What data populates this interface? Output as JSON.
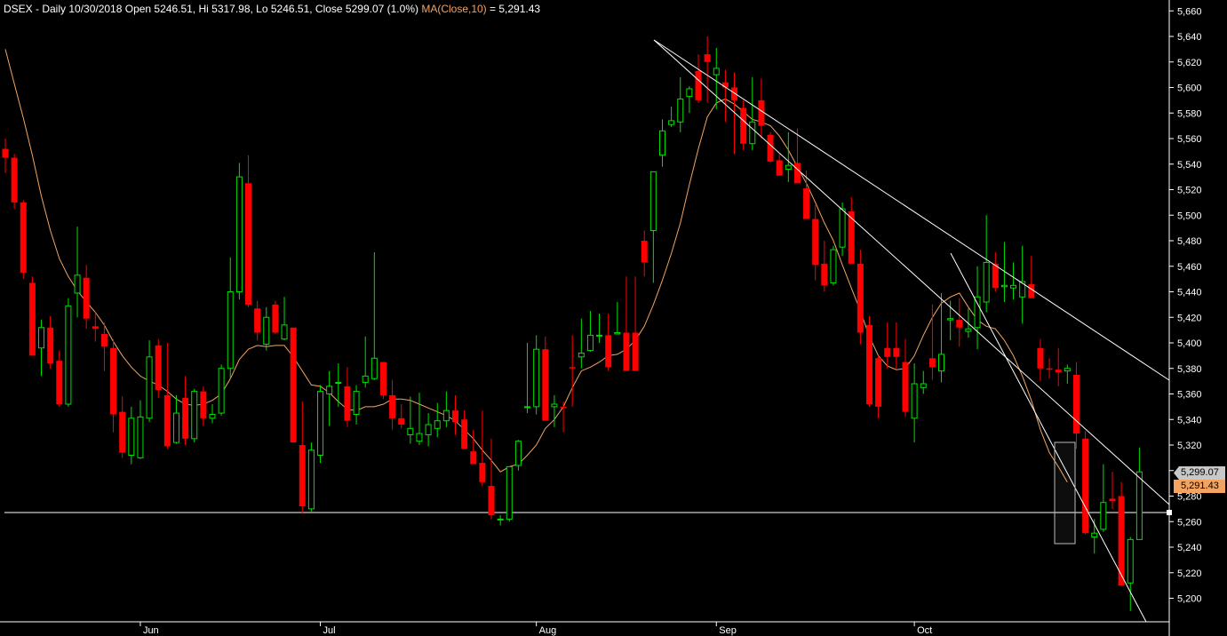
{
  "header": {
    "symbol_info": "DSEX - Daily 10/30/2018 Open 5246.51, Hi 5317.98, Lo 5246.51, Close 5299.07 (1.0%)",
    "ma_label": "MA(Close,10)",
    "ma_value": " = 5,291.43"
  },
  "price_tags": {
    "close": "5,299.07",
    "ma": "5,291.43"
  },
  "colors": {
    "background": "#000000",
    "up": "#00e000",
    "down": "#ff0000",
    "ma": "#f4a460",
    "trendline": "#ffffff",
    "axis_text": "#ffffff",
    "close_tag": "#c8c8c8",
    "ma_tag": "#f4a460"
  },
  "chart_data": {
    "type": "candlestick",
    "title": "DSEX - Daily",
    "ylim": [
      5190,
      5670
    ],
    "y_ticks": [
      5200,
      5220,
      5240,
      5260,
      5280,
      5300,
      5320,
      5340,
      5360,
      5380,
      5400,
      5420,
      5440,
      5460,
      5480,
      5500,
      5520,
      5540,
      5560,
      5580,
      5600,
      5620,
      5640,
      5660
    ],
    "y_tick_labels": [
      "5,200",
      "5,220",
      "5,240",
      "5,260",
      "5,280",
      "5,300",
      "5,320",
      "5,340",
      "5,360",
      "5,380",
      "5,400",
      "5,420",
      "5,440",
      "5,460",
      "5,480",
      "5,500",
      "5,520",
      "5,540",
      "5,560",
      "5,580",
      "5,600",
      "5,620",
      "5,640",
      "5,660"
    ],
    "x_labels": [
      {
        "label": "Jun",
        "index": 15
      },
      {
        "label": "Jul",
        "index": 35
      },
      {
        "label": "Aug",
        "index": 59
      },
      {
        "label": "Sep",
        "index": 79
      },
      {
        "label": "Oct",
        "index": 101
      }
    ],
    "candles": [
      [
        5552,
        5560,
        5533,
        5545
      ],
      [
        5545,
        5548,
        5505,
        5510
      ],
      [
        5510,
        5512,
        5450,
        5455
      ],
      [
        5447,
        5452,
        5390,
        5390
      ],
      [
        5396,
        5418,
        5374,
        5412
      ],
      [
        5412,
        5421,
        5380,
        5384
      ],
      [
        5386,
        5394,
        5350,
        5352
      ],
      [
        5352,
        5435,
        5350,
        5429
      ],
      [
        5439,
        5491,
        5420,
        5453
      ],
      [
        5451,
        5461,
        5411,
        5419
      ],
      [
        5413,
        5424,
        5401,
        5411
      ],
      [
        5407,
        5416,
        5378,
        5397
      ],
      [
        5396,
        5403,
        5330,
        5344
      ],
      [
        5346,
        5358,
        5310,
        5314
      ],
      [
        5312,
        5350,
        5305,
        5341
      ],
      [
        5310,
        5355,
        5309,
        5342
      ],
      [
        5341,
        5402,
        5338,
        5389
      ],
      [
        5398,
        5403,
        5357,
        5363
      ],
      [
        5359,
        5400,
        5317,
        5319
      ],
      [
        5322,
        5359,
        5321,
        5345
      ],
      [
        5357,
        5374,
        5320,
        5325
      ],
      [
        5325,
        5364,
        5322,
        5362
      ],
      [
        5362,
        5366,
        5335,
        5341
      ],
      [
        5341,
        5352,
        5337,
        5344
      ],
      [
        5345,
        5383,
        5343,
        5380
      ],
      [
        5380,
        5467,
        5372,
        5440
      ],
      [
        5440,
        5541,
        5434,
        5530
      ],
      [
        5525,
        5547,
        5428,
        5430
      ],
      [
        5427,
        5433,
        5402,
        5408
      ],
      [
        5399,
        5428,
        5394,
        5420
      ],
      [
        5430,
        5433,
        5407,
        5408
      ],
      [
        5403,
        5436,
        5402,
        5414
      ],
      [
        5412,
        5411,
        5389,
        5322
      ],
      [
        5320,
        5354,
        5267,
        5272
      ],
      [
        5270,
        5322,
        5268,
        5316
      ],
      [
        5312,
        5367,
        5306,
        5362
      ],
      [
        5360,
        5378,
        5335,
        5366
      ],
      [
        5369,
        5384,
        5350,
        5369
      ],
      [
        5366,
        5381,
        5334,
        5339
      ],
      [
        5344,
        5367,
        5336,
        5362
      ],
      [
        5369,
        5405,
        5365,
        5374
      ],
      [
        5372,
        5471,
        5371,
        5388
      ],
      [
        5385,
        5385,
        5356,
        5359
      ],
      [
        5359,
        5371,
        5332,
        5341
      ],
      [
        5341,
        5352,
        5333,
        5336
      ],
      [
        5328,
        5358,
        5321,
        5333
      ],
      [
        5323,
        5361,
        5320,
        5329
      ],
      [
        5328,
        5345,
        5319,
        5336
      ],
      [
        5333,
        5353,
        5326,
        5339
      ],
      [
        5339,
        5362,
        5334,
        5347
      ],
      [
        5347,
        5359,
        5328,
        5338
      ],
      [
        5340,
        5347,
        5322,
        5317
      ],
      [
        5315,
        5332,
        5306,
        5305
      ],
      [
        5306,
        5347,
        5288,
        5291
      ],
      [
        5288,
        5325,
        5262,
        5265
      ],
      [
        5262,
        5265,
        5257,
        5262
      ],
      [
        5262,
        5302,
        5260,
        5303
      ],
      [
        5304,
        5324,
        5300,
        5323
      ],
      [
        5350,
        5400,
        5345,
        5350
      ],
      [
        5350,
        5406,
        5344,
        5395
      ],
      [
        5395,
        5405,
        5340,
        5339
      ],
      [
        5350,
        5359,
        5334,
        5352
      ],
      [
        5350,
        5354,
        5330,
        5349
      ],
      [
        5381,
        5406,
        5350,
        5380
      ],
      [
        5389,
        5419,
        5380,
        5392
      ],
      [
        5394,
        5425,
        5393,
        5406
      ],
      [
        5406,
        5423,
        5400,
        5406
      ],
      [
        5406,
        5423,
        5378,
        5381
      ],
      [
        5407,
        5432,
        5408,
        5408
      ],
      [
        5408,
        5452,
        5380,
        5378
      ],
      [
        5408,
        5452,
        5379,
        5378
      ],
      [
        5480,
        5488,
        5452,
        5463
      ],
      [
        5488,
        5531,
        5447,
        5534
      ],
      [
        5547,
        5575,
        5538,
        5566
      ],
      [
        5571,
        5585,
        5569,
        5574
      ],
      [
        5573,
        5608,
        5565,
        5591
      ],
      [
        5593,
        5601,
        5580,
        5599
      ],
      [
        5613,
        5626,
        5588,
        5590
      ],
      [
        5626,
        5640,
        5588,
        5620
      ],
      [
        5610,
        5631,
        5583,
        5615
      ],
      [
        5604,
        5614,
        5573,
        5600
      ],
      [
        5600,
        5612,
        5548,
        5590
      ],
      [
        5584,
        5590,
        5551,
        5556
      ],
      [
        5556,
        5608,
        5551,
        5573
      ],
      [
        5590,
        5607,
        5560,
        5570
      ],
      [
        5563,
        5565,
        5541,
        5542
      ],
      [
        5543,
        5548,
        5531,
        5531
      ],
      [
        5536,
        5565,
        5526,
        5539
      ],
      [
        5541,
        5568,
        5535,
        5525
      ],
      [
        5521,
        5535,
        5512,
        5497
      ],
      [
        5497,
        5508,
        5449,
        5461
      ],
      [
        5462,
        5480,
        5440,
        5445
      ],
      [
        5447,
        5476,
        5445,
        5473
      ],
      [
        5475,
        5510,
        5468,
        5505
      ],
      [
        5503,
        5514,
        5463,
        5462
      ],
      [
        5462,
        5473,
        5399,
        5408
      ],
      [
        5414,
        5421,
        5350,
        5352
      ],
      [
        5388,
        5390,
        5341,
        5350
      ],
      [
        5396,
        5416,
        5380,
        5389
      ],
      [
        5396,
        5416,
        5380,
        5389
      ],
      [
        5385,
        5403,
        5342,
        5346
      ],
      [
        5341,
        5384,
        5322,
        5368
      ],
      [
        5365,
        5378,
        5360,
        5368
      ],
      [
        5388,
        5430,
        5371,
        5381
      ],
      [
        5378,
        5439,
        5369,
        5391
      ],
      [
        5418,
        5433,
        5402,
        5419
      ],
      [
        5418,
        5435,
        5397,
        5412
      ],
      [
        5409,
        5427,
        5404,
        5411
      ],
      [
        5412,
        5460,
        5395,
        5436
      ],
      [
        5432,
        5500,
        5424,
        5463
      ],
      [
        5462,
        5471,
        5440,
        5443
      ],
      [
        5444,
        5479,
        5432,
        5445
      ],
      [
        5443,
        5463,
        5434,
        5445
      ],
      [
        5436,
        5476,
        5415,
        5448
      ],
      [
        5446,
        5468,
        5437,
        5435
      ],
      [
        5396,
        5403,
        5370,
        5380
      ],
      [
        5380,
        5388,
        5372,
        5379
      ],
      [
        5379,
        5396,
        5366,
        5377
      ],
      [
        5378,
        5383,
        5368,
        5380
      ],
      [
        5375,
        5385,
        5317,
        5329
      ],
      [
        5325,
        5331,
        5250,
        5251
      ],
      [
        5248,
        5262,
        5235,
        5251
      ],
      [
        5254,
        5305,
        5252,
        5275
      ],
      [
        5278,
        5299,
        5270,
        5276
      ],
      [
        5280,
        5291,
        5210,
        5210
      ],
      [
        5212,
        5248,
        5190,
        5246
      ],
      [
        5246,
        5318,
        5246,
        5299
      ]
    ],
    "ma10": [
      5630,
      5603,
      5576,
      5547,
      5515,
      5488,
      5466,
      5452,
      5441,
      5432,
      5424,
      5414,
      5401,
      5390,
      5381,
      5374,
      5370,
      5367,
      5362,
      5356,
      5352,
      5351,
      5352,
      5355,
      5360,
      5372,
      5387,
      5395,
      5398,
      5397,
      5398,
      5398,
      5389,
      5378,
      5367,
      5366,
      5361,
      5354,
      5348,
      5347,
      5350,
      5350,
      5352,
      5356,
      5356,
      5355,
      5352,
      5349,
      5346,
      5343,
      5339,
      5332,
      5325,
      5316,
      5308,
      5299,
      5303,
      5305,
      5312,
      5320,
      5333,
      5340,
      5350,
      5365,
      5378,
      5381,
      5385,
      5390,
      5391,
      5395,
      5402,
      5413,
      5430,
      5449,
      5470,
      5494,
      5524,
      5552,
      5577,
      5588,
      5591,
      5587,
      5581,
      5575,
      5573,
      5570,
      5562,
      5551,
      5538,
      5525,
      5510,
      5494,
      5480,
      5461,
      5443,
      5425,
      5405,
      5390,
      5382,
      5379,
      5380,
      5390,
      5406,
      5420,
      5431,
      5436,
      5439,
      5428,
      5418,
      5413,
      5411,
      5402,
      5390,
      5374,
      5355,
      5332,
      5314,
      5303,
      5291
    ]
  }
}
